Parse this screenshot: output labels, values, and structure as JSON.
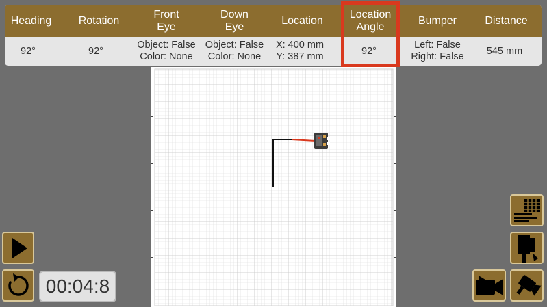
{
  "sensors": {
    "headers": [
      {
        "id": "heading",
        "label": "Heading"
      },
      {
        "id": "rotation",
        "label": "Rotation"
      },
      {
        "id": "front_eye",
        "label": "Front\nEye"
      },
      {
        "id": "down_eye",
        "label": "Down\nEye"
      },
      {
        "id": "location",
        "label": "Location"
      },
      {
        "id": "location_angle",
        "label": "Location\nAngle"
      },
      {
        "id": "bumper",
        "label": "Bumper"
      },
      {
        "id": "distance",
        "label": "Distance"
      }
    ],
    "values": {
      "heading": "92°",
      "rotation": "92°",
      "front_eye": "Object: False\nColor: None",
      "down_eye": "Object: False\nColor: None",
      "location": "X: 400 mm\nY: 387 mm",
      "location_angle": "92°",
      "bumper": "Left: False\nRight: False",
      "distance": "545 mm"
    },
    "highlighted_column": "location_angle",
    "highlight_color": "#d9391e"
  },
  "timer": {
    "value": "00:04:8"
  },
  "controls": {
    "play_icon": "play-icon",
    "restart_icon": "restart-icon",
    "data_table_icon": "data-table-icon",
    "robot_view_icon": "robot-view-icon",
    "record_video_icon": "record-video-icon",
    "camera_icon": "camera-icon"
  },
  "colors": {
    "background": "#6e6e6e",
    "header_bar": "#8c6d2f",
    "value_bar": "#e6e6e6",
    "trail_red": "#d9391e",
    "trail_black": "#111111"
  }
}
